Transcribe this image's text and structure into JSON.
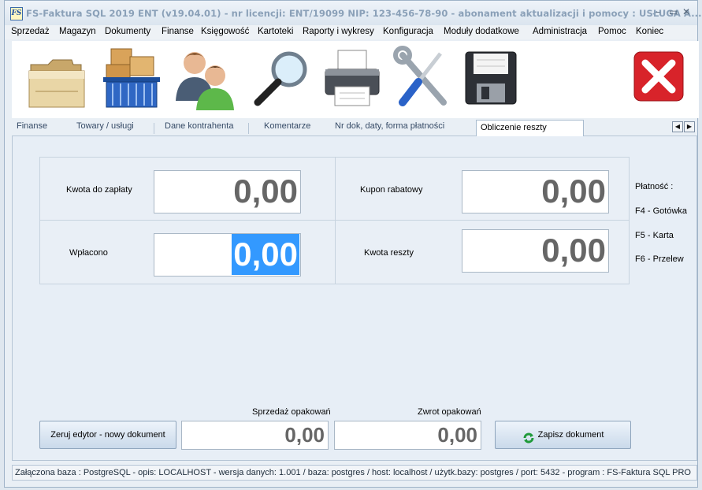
{
  "window": {
    "app_icon": "FS",
    "title": "FS-Faktura SQL 2019 ENT (v19.04.01)    -    nr licencji: ENT/19099     NIP: 123-456-78-90     -    abonament aktualizacji i pomocy : USŁUGA A...",
    "minimize_icon": "minimize-icon",
    "maximize_icon": "maximize-icon",
    "close_icon": "close-icon"
  },
  "menu": {
    "items": [
      "Sprzedaż",
      "Magazyn",
      "Dokumenty",
      "Finanse",
      "Księgowość",
      "Kartoteki",
      "Raporty i wykresy",
      "Konfiguracja",
      "Moduły dodatkowe",
      "Administracja",
      "Pomoc",
      "Koniec"
    ]
  },
  "toolbar": {
    "icons": [
      "folder-icon",
      "warehouse-basket-icon",
      "contractors-people-icon",
      "magnifier-search-icon",
      "printer-icon",
      "tools-settings-icon",
      "floppy-save-icon",
      "close-red-icon"
    ]
  },
  "tabs": {
    "items": [
      "Finanse",
      "Towary  / usługi",
      "Dane kontrahenta",
      "Komentarze",
      "Nr dok, daty, forma płatności",
      "Obliczenie reszty"
    ],
    "active": "Obliczenie reszty",
    "scroll_left": "◀",
    "scroll_right": "▶"
  },
  "calc": {
    "amount_due_label": "Kwota do zapłaty",
    "amount_due_value": "0,00",
    "coupon_label": "Kupon rabatowy",
    "coupon_value": "0,00",
    "paid_label": "Wpłacono",
    "paid_value": "0,00",
    "change_label": "Kwota reszty",
    "change_value": "0,00"
  },
  "payment": {
    "title": "Płatność :",
    "cash": "F4 - Gotówka",
    "card": "F5 - Karta",
    "transfer": "F6 - Przelew"
  },
  "bottom": {
    "reset_button": "Zeruj edytor  -  nowy dokument",
    "packaging_sale_label": "Sprzedaż opakowań",
    "packaging_sale_value": "0,00",
    "packaging_return_label": "Zwrot opakowań",
    "packaging_return_value": "0,00",
    "save_button": "Zapisz dokument"
  },
  "status": {
    "text": "Załączona baza : PostgreSQL - opis: LOCALHOST - wersja danych: 1.001  / baza: postgres / host: localhost / użytk.bazy: postgres /  port: 5432  -  program :  FS-Faktura SQL PRO"
  },
  "colors": {
    "selection": "#3399ff",
    "value_text": "#666666",
    "close_red": "#d8232a"
  }
}
